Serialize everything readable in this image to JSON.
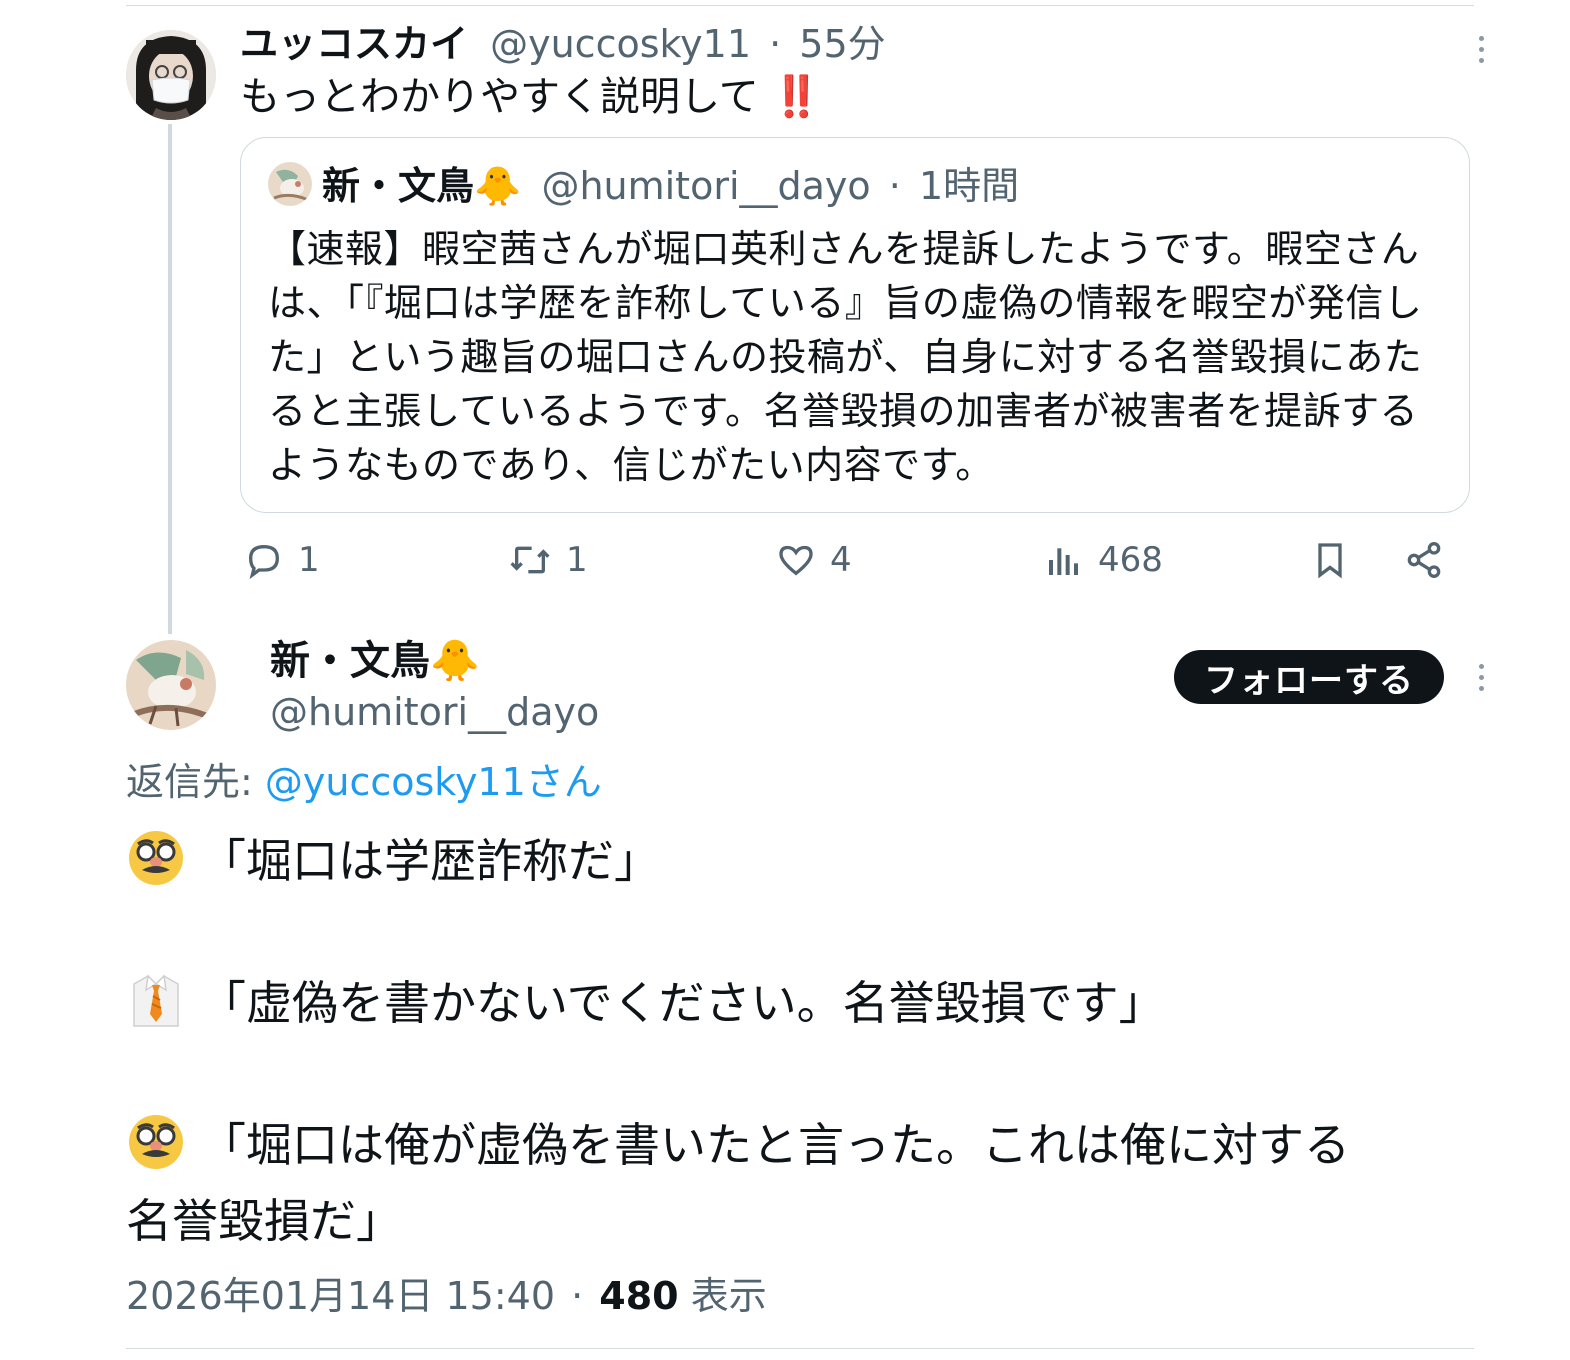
{
  "reply": {
    "author_name": "ユッコスカイ",
    "handle": "@yuccosky11",
    "separator": "·",
    "time": "55分",
    "text": "もっとわかりやすく説明して",
    "text_emoji": "‼️"
  },
  "quoted": {
    "author_name": "新・文鳥",
    "name_emoji": "🐥",
    "handle": "@humitori__dayo",
    "separator": "·",
    "time": "1時間",
    "text": "【速報】暇空茜さんが堀口英利さんを提訴したようです。暇空さんは、「『堀口は学歴を詐称している』旨の虚偽の情報を暇空が発信した」という趣旨の堀口さんの投稿が、自身に対する名誉毀損にあたると主張しているようです。名誉毀損の加害者が被害者を提訴するようなものであり、信じがたい内容です。"
  },
  "actions": {
    "reply_count": "1",
    "repost_count": "1",
    "like_count": "4",
    "view_count": "468"
  },
  "main": {
    "author_name": "新・文鳥",
    "name_emoji": "🐥",
    "handle": "@humitori__dayo",
    "follow_label": "フォローする",
    "reply_to_label": "返信先: ",
    "reply_to_handle": "@yuccosky11さん",
    "lines": [
      "「堀口は学歴詐称だ」",
      "「虚偽を書かないでください。名誉毀損です」",
      "「堀口は俺が虚偽を書いたと言った。これは俺に対する",
      "名誉毀損だ」"
    ],
    "emoji_disguise": "🥸",
    "emoji_suit": "👔",
    "timestamp": "2026年01月14日 15:40",
    "separator": "·",
    "views": "480",
    "views_label": " 表示"
  },
  "colors": {
    "text": "#0f1419",
    "muted": "#536471",
    "link": "#1d9bf0",
    "border": "#cfd9de",
    "button_bg": "#0f1419"
  },
  "icons": [
    "reply-icon",
    "repost-icon",
    "like-icon",
    "views-icon",
    "bookmark-icon",
    "share-icon",
    "more-icon"
  ]
}
